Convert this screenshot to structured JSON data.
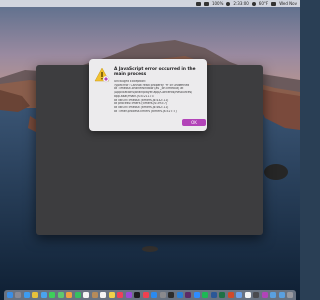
{
  "menubar": {
    "items": [
      "100%",
      "2:33:00",
      "60°F",
      "Wed Nov"
    ]
  },
  "alert": {
    "title": "A JavaScript error occurred in the main process",
    "icon": "warning-triangle-icon",
    "body_lines": [
      "Uncaught Exception:",
      "TypeError: Cannot read property 'ff' of undefined",
      "at Timeout.onlineWindow (as _onTimeout) at",
      "/Applications/Brainplayer.app/Contents/Resources/",
      "app.asar/main.js:4:21173",
      "at listOnTimeout (timers.js:432:11)",
      "at processTimers (timers.js:393:7)",
      "at listOnTimeout (timers.js:462:11)",
      "at Timer.processTimers (timers.js:527:7)"
    ],
    "ok_label": "OK"
  },
  "colors": {
    "accent": "#b243b8",
    "alert_bg": "#ecebed",
    "app_window_bg": "#3d3d3f"
  },
  "dock": {
    "icons": [
      "finder-icon",
      "launchpad-icon",
      "safari-icon",
      "chrome-icon",
      "mail-icon",
      "messages-icon",
      "maps-icon",
      "photos-icon",
      "facetime-icon",
      "calendar-icon",
      "contacts-icon",
      "reminders-icon",
      "notes-icon",
      "music-icon",
      "podcasts-icon",
      "tv-icon",
      "news-icon",
      "appstore-icon",
      "settings-icon",
      "terminal-icon",
      "vscode-icon",
      "slack-icon",
      "zoom-icon",
      "spotify-icon",
      "word-icon",
      "excel-icon",
      "powerpoint-icon",
      "preview-icon",
      "textedit-icon",
      "activity-monitor-icon",
      "brainplayer-icon",
      "folder-icon",
      "downloads-icon",
      "trash-icon"
    ],
    "colors": [
      "#3a8ee6",
      "#8a8a94",
      "#3c9cf0",
      "#e8c13b",
      "#4aa3f0",
      "#3dcf5a",
      "#5fc96e",
      "#f0a040",
      "#36c060",
      "#f4f4f4",
      "#b58b5a",
      "#f4f4f4",
      "#f0d24a",
      "#f0405a",
      "#9a4ad8",
      "#1c1c1e",
      "#f04050",
      "#2a8af0",
      "#8a8a8e",
      "#2c2c2c",
      "#2a7fd4",
      "#5b2a66",
      "#2d8cff",
      "#1db954",
      "#2b5797",
      "#1e7145",
      "#d04a2a",
      "#6aa0e8",
      "#f4f4f4",
      "#4a4a4e",
      "#b243b8",
      "#5aa0e0",
      "#5aa0e0",
      "#9a9aa0"
    ]
  }
}
